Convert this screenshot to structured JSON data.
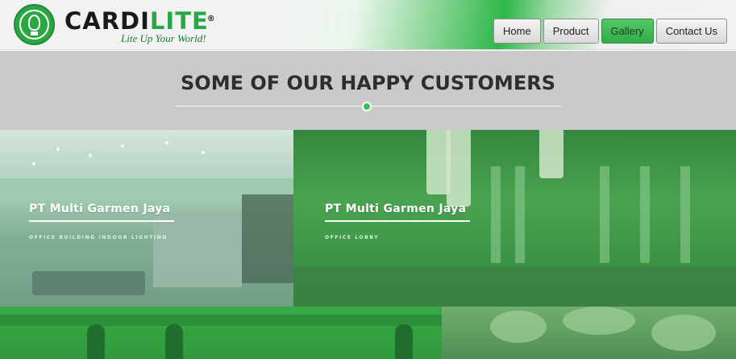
{
  "header": {
    "brand_part1": "CARDI",
    "brand_part2": "LITE",
    "registered_mark": "®",
    "tagline": "Lite Up Your World!",
    "logo_icon": "cardilite-seal-icon",
    "colors": {
      "brand_green": "#28a745",
      "nav_active": "#3cb552"
    }
  },
  "nav": {
    "items": [
      {
        "label": "Home",
        "active": false
      },
      {
        "label": "Product",
        "active": false
      },
      {
        "label": "Gallery",
        "active": true
      },
      {
        "label": "Contact Us",
        "active": false
      }
    ]
  },
  "section": {
    "title": "SOME OF OUR HAPPY CUSTOMERS",
    "divider_icon": "green-dot-icon"
  },
  "gallery": {
    "tiles": [
      {
        "title": "PT Multi Garmen Jaya",
        "subtitle": "OFFICE BUILDING INDOOR LIGHTING"
      },
      {
        "title": "PT Multi Garmen Jaya",
        "subtitle": "OFFICE LOBBY"
      },
      {
        "title": "",
        "subtitle": ""
      },
      {
        "title": "",
        "subtitle": ""
      }
    ]
  }
}
